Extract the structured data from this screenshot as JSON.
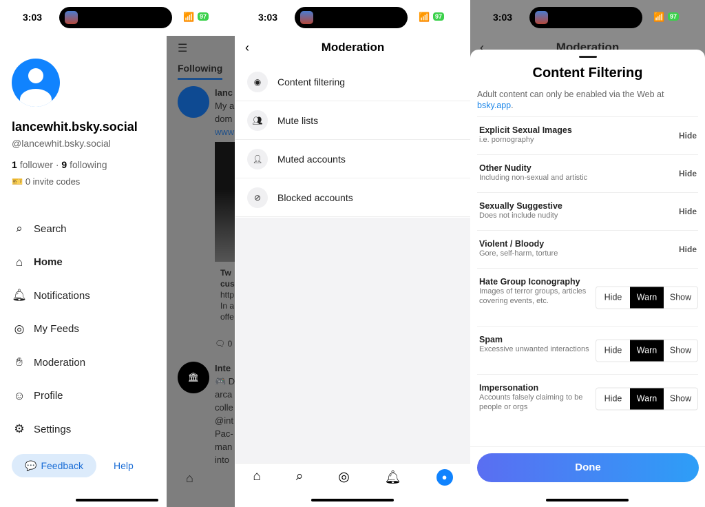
{
  "status": {
    "time": "3:03",
    "battery": "97"
  },
  "drawer": {
    "display_name": "lancewhit.bsky.social",
    "handle": "@lancewhit.bsky.social",
    "followers_count": "1",
    "followers_label": "follower",
    "following_count": "9",
    "following_label": "following",
    "invite_codes": "0 invite codes",
    "nav": [
      {
        "label": "Search",
        "icon": "search-icon"
      },
      {
        "label": "Home",
        "icon": "home-icon"
      },
      {
        "label": "Notifications",
        "icon": "bell-icon"
      },
      {
        "label": "My Feeds",
        "icon": "feeds-icon"
      },
      {
        "label": "Moderation",
        "icon": "hand-icon"
      },
      {
        "label": "Profile",
        "icon": "profile-icon"
      },
      {
        "label": "Settings",
        "icon": "gear-icon"
      }
    ],
    "feedback": "Feedback",
    "help": "Help",
    "feed": {
      "tab": "Following",
      "lines1": [
        "lanc",
        "My a",
        "dom",
        "www"
      ],
      "card": [
        "Tw",
        "cus",
        "http",
        "In a",
        "offe"
      ],
      "reply_count": "0",
      "lines2": [
        "Inte",
        "🎮 D",
        "arca",
        "colle",
        "@int",
        "Pac-",
        "man",
        "into"
      ]
    }
  },
  "moderation": {
    "title": "Moderation",
    "items": [
      {
        "label": "Content filtering",
        "icon": "eye-icon"
      },
      {
        "label": "Mute lists",
        "icon": "users-icon"
      },
      {
        "label": "Muted accounts",
        "icon": "muted-user-icon"
      },
      {
        "label": "Blocked accounts",
        "icon": "block-icon"
      }
    ]
  },
  "filtering": {
    "bg_title": "Moderation",
    "title": "Content Filtering",
    "intro": "Adult content can only be enabled via the Web at ",
    "intro_link": "bsky.app",
    "intro_end": ".",
    "rows": [
      {
        "title": "Explicit Sexual Images",
        "desc": "i.e. pornography",
        "value": "Hide"
      },
      {
        "title": "Other Nudity",
        "desc": "Including non-sexual and artistic",
        "value": "Hide"
      },
      {
        "title": "Sexually Suggestive",
        "desc": "Does not include nudity",
        "value": "Hide"
      },
      {
        "title": "Violent / Bloody",
        "desc": "Gore, self-harm, torture",
        "value": "Hide"
      }
    ],
    "seg_rows": [
      {
        "title": "Hate Group Iconography",
        "desc": "Images of terror groups, articles covering events, etc.",
        "selected": "Warn"
      },
      {
        "title": "Spam",
        "desc": "Excessive unwanted interactions",
        "selected": "Warn"
      },
      {
        "title": "Impersonation",
        "desc": "Accounts falsely claiming to be people or orgs",
        "selected": "Warn"
      }
    ],
    "options": [
      "Hide",
      "Warn",
      "Show"
    ],
    "done": "Done"
  }
}
